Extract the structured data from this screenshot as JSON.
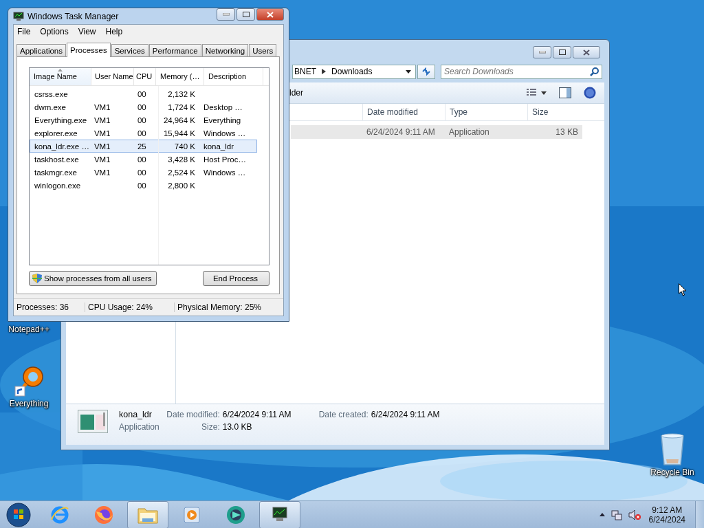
{
  "desktop": {
    "icons": [
      {
        "kind": "notepadpp",
        "label": "Notepad++"
      },
      {
        "kind": "everything",
        "label": "Everything"
      },
      {
        "kind": "recycle_bin",
        "label": "Recycle Bin"
      }
    ]
  },
  "explorer": {
    "breadcrumb": [
      "BNET",
      "Downloads"
    ],
    "search_placeholder": "Search Downloads",
    "toolbar_item": "lder",
    "columns": [
      "Date modified",
      "Type",
      "Size"
    ],
    "rows": [
      {
        "date_modified": "6/24/2024 9:11 AM",
        "type": "Application",
        "size": "13 KB",
        "selected": true
      }
    ],
    "details": {
      "name": "kona_ldr",
      "type": "Application",
      "date_modified_label": "Date modified:",
      "date_modified": "6/24/2024 9:11 AM",
      "date_created_label": "Date created:",
      "date_created": "6/24/2024 9:11 AM",
      "size_label": "Size:",
      "size": "13.0 KB"
    }
  },
  "task_manager": {
    "title": "Windows Task Manager",
    "menu": [
      "File",
      "Options",
      "View",
      "Help"
    ],
    "tabs": [
      {
        "label": "Applications",
        "selected": false
      },
      {
        "label": "Processes",
        "selected": true
      },
      {
        "label": "Services",
        "selected": false
      },
      {
        "label": "Performance",
        "selected": false
      },
      {
        "label": "Networking",
        "selected": false
      },
      {
        "label": "Users",
        "selected": false
      }
    ],
    "columns": [
      {
        "label": "Image Name",
        "sorted": true
      },
      {
        "label": "User Name",
        "sorted": false
      },
      {
        "label": "CPU",
        "sorted": false
      },
      {
        "label": "Memory (…",
        "sorted": false
      },
      {
        "label": "Description",
        "sorted": false
      }
    ],
    "rows": [
      {
        "image": "csrss.exe",
        "user": "",
        "cpu": "00",
        "memory": "2,132 K",
        "description": "",
        "selected": false
      },
      {
        "image": "dwm.exe",
        "user": "VM1",
        "cpu": "00",
        "memory": "1,724 K",
        "description": "Desktop …",
        "selected": false
      },
      {
        "image": "Everything.exe",
        "user": "VM1",
        "cpu": "00",
        "memory": "24,964 K",
        "description": "Everything",
        "selected": false
      },
      {
        "image": "explorer.exe",
        "user": "VM1",
        "cpu": "00",
        "memory": "15,944 K",
        "description": "Windows …",
        "selected": false
      },
      {
        "image": "kona_ldr.exe …",
        "user": "VM1",
        "cpu": "25",
        "memory": "740 K",
        "description": "kona_ldr",
        "selected": true
      },
      {
        "image": "taskhost.exe",
        "user": "VM1",
        "cpu": "00",
        "memory": "3,428 K",
        "description": "Host Proc…",
        "selected": false
      },
      {
        "image": "taskmgr.exe",
        "user": "VM1",
        "cpu": "00",
        "memory": "2,524 K",
        "description": "Windows …",
        "selected": false
      },
      {
        "image": "winlogon.exe",
        "user": "",
        "cpu": "00",
        "memory": "2,800 K",
        "description": "",
        "selected": false
      }
    ],
    "show_all_button": "Show processes from all users",
    "end_button": "End Process",
    "status": [
      "Processes: 36",
      "CPU Usage: 24%",
      "Physical Memory: 25%"
    ]
  },
  "taskbar": {
    "apps": [
      {
        "kind": "ie",
        "running": false
      },
      {
        "kind": "firefox",
        "running": false
      },
      {
        "kind": "explorer",
        "running": true
      },
      {
        "kind": "media",
        "running": false
      },
      {
        "kind": "app",
        "running": false
      },
      {
        "kind": "taskmgr",
        "running": true
      }
    ],
    "volume_muted": true,
    "time": "9:12 AM",
    "date": "6/24/2024"
  }
}
